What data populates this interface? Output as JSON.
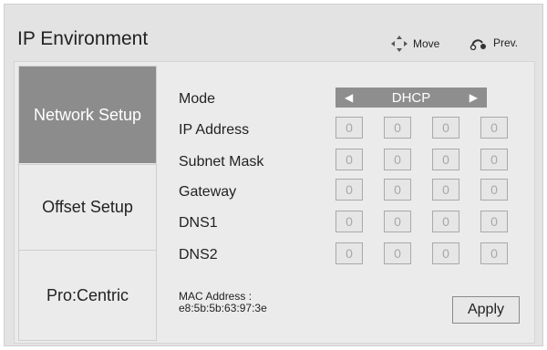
{
  "header": {
    "title": "IP Environment",
    "hints": [
      {
        "icon": "move-arrows-icon",
        "label": "Move"
      },
      {
        "icon": "back-return-icon",
        "label": "Prev."
      }
    ]
  },
  "menu": {
    "items": [
      {
        "label": "Network Setup",
        "selected": true
      },
      {
        "label": "Offset Setup",
        "selected": false
      },
      {
        "label": "Pro:Centric",
        "selected": false
      }
    ]
  },
  "form": {
    "mode": {
      "label": "Mode",
      "value": "DHCP"
    },
    "ip_address": {
      "label": "IP Address",
      "octets": [
        "0",
        "0",
        "0",
        "0"
      ]
    },
    "subnet_mask": {
      "label": "Subnet Mask",
      "octets": [
        "0",
        "0",
        "0",
        "0"
      ]
    },
    "gateway": {
      "label": "Gateway",
      "octets": [
        "0",
        "0",
        "0",
        "0"
      ]
    },
    "dns1": {
      "label": "DNS1",
      "octets": [
        "0",
        "0",
        "0",
        "0"
      ]
    },
    "dns2": {
      "label": "DNS2",
      "octets": [
        "0",
        "0",
        "0",
        "0"
      ]
    },
    "mac_label": "MAC Address :",
    "mac_value": "e8:5b:5b:63:97:3e",
    "apply_label": "Apply"
  },
  "colors": {
    "selected_menu_bg": "#8c8c8c",
    "mode_select_bg": "#8e8e8e",
    "panel_bg": "#ebebeb"
  }
}
